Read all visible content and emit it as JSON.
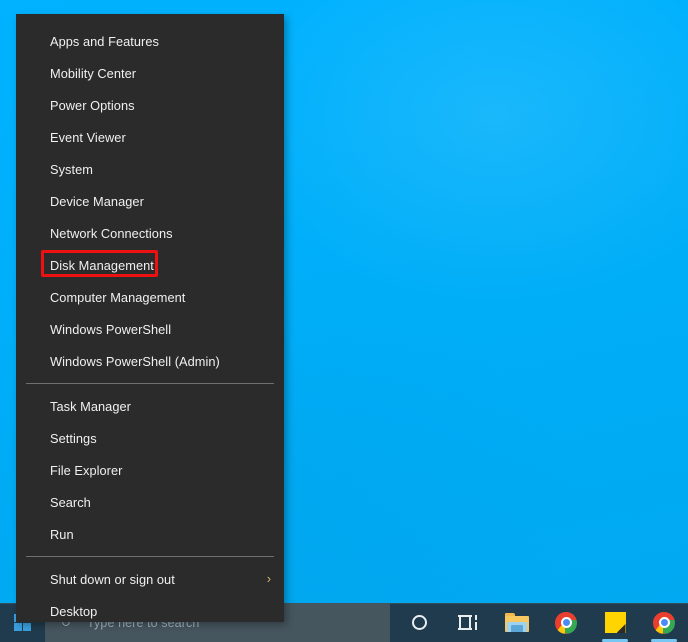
{
  "desktop": {
    "background_color": "#00aef8"
  },
  "context_menu": {
    "name": "Windows quick link menu",
    "groups": [
      {
        "items": [
          {
            "label": "Apps and Features",
            "icon": null,
            "submenu": false
          },
          {
            "label": "Mobility Center",
            "icon": null,
            "submenu": false
          },
          {
            "label": "Power Options",
            "icon": null,
            "submenu": false
          },
          {
            "label": "Event Viewer",
            "icon": null,
            "submenu": false
          },
          {
            "label": "System",
            "icon": null,
            "submenu": false
          },
          {
            "label": "Device Manager",
            "icon": null,
            "submenu": false
          },
          {
            "label": "Network Connections",
            "icon": null,
            "submenu": false
          },
          {
            "label": "Disk Management",
            "icon": null,
            "submenu": false,
            "highlighted": true
          },
          {
            "label": "Computer Management",
            "icon": null,
            "submenu": false
          },
          {
            "label": "Windows PowerShell",
            "icon": null,
            "submenu": false
          },
          {
            "label": "Windows PowerShell (Admin)",
            "icon": null,
            "submenu": false
          }
        ]
      },
      {
        "items": [
          {
            "label": "Task Manager",
            "icon": null,
            "submenu": false
          },
          {
            "label": "Settings",
            "icon": null,
            "submenu": false
          },
          {
            "label": "File Explorer",
            "icon": null,
            "submenu": false
          },
          {
            "label": "Search",
            "icon": null,
            "submenu": false
          },
          {
            "label": "Run",
            "icon": null,
            "submenu": false
          }
        ]
      },
      {
        "items": [
          {
            "label": "Shut down or sign out",
            "icon": "chevron-right-icon",
            "submenu": true,
            "chevron": "›"
          },
          {
            "label": "Desktop",
            "icon": null,
            "submenu": false
          }
        ]
      }
    ]
  },
  "annotation": {
    "type": "highlight-rectangle",
    "target_label": "Disk Management",
    "color": "#ee1111"
  },
  "taskbar": {
    "background_color": "#1f3b4d",
    "start_button": {
      "icon": "windows-logo-icon",
      "label": "Start"
    },
    "search": {
      "icon": "cortana-circle-icon",
      "placeholder": "Type here to search",
      "value": ""
    },
    "icons": [
      {
        "name": "cortana-icon",
        "label": "Cortana",
        "running": false
      },
      {
        "name": "task-view-icon",
        "label": "Task View",
        "running": false
      },
      {
        "name": "file-explorer-icon",
        "label": "File Explorer",
        "running": false
      },
      {
        "name": "chrome-icon",
        "label": "Google Chrome",
        "running": false
      },
      {
        "name": "sticky-notes-icon",
        "label": "Sticky Notes",
        "running": true
      },
      {
        "name": "chrome-icon-2",
        "label": "Google Chrome",
        "running": true
      }
    ]
  }
}
